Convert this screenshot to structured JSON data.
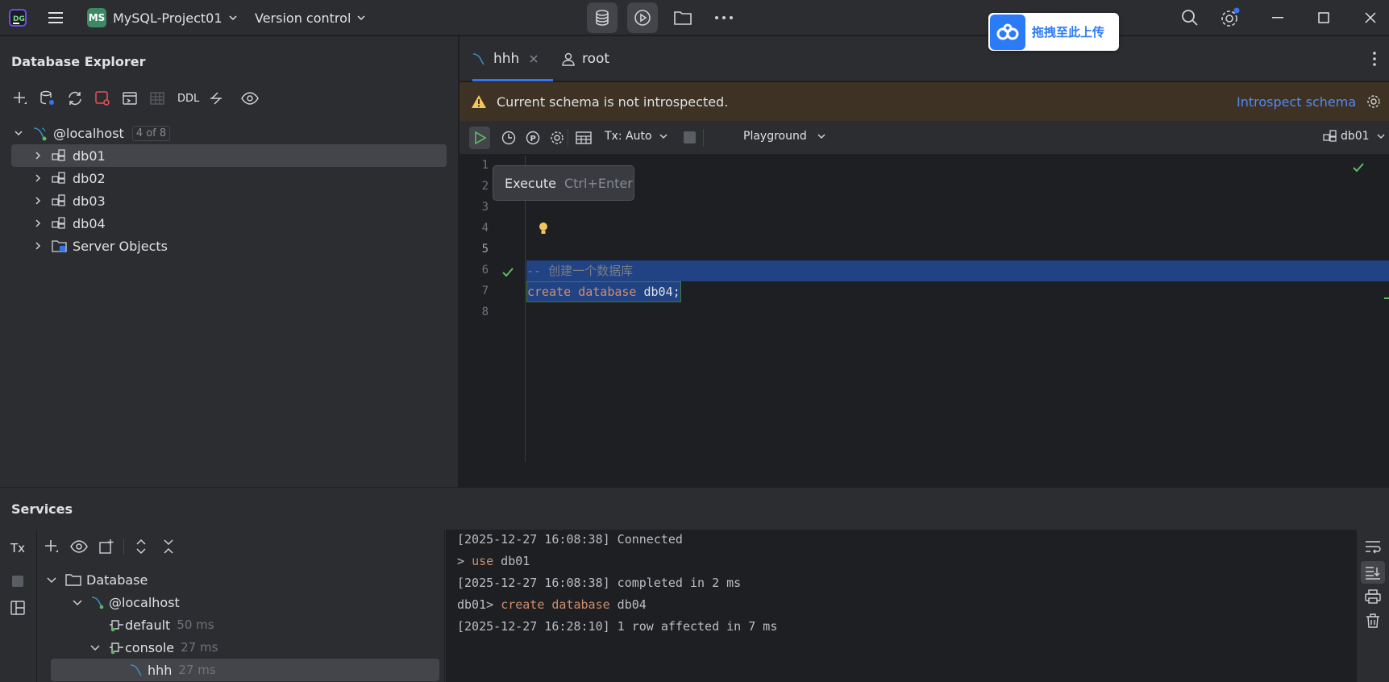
{
  "titlebar": {
    "project_badge": "MS",
    "project_name": "MySQL-Project01",
    "vcs_label": "Version control",
    "icons": [
      "app-logo-icon",
      "hamburger-icon",
      "database-icon",
      "run-services-icon",
      "folder-icon",
      "more-icon",
      "search-icon",
      "settings-icon",
      "minimize-icon",
      "maximize-icon",
      "close-icon"
    ]
  },
  "upload_badge": {
    "label": "拖拽至此上传",
    "icon": "baidu-cloud-icon"
  },
  "explorer": {
    "title": "Database Explorer",
    "ddl_label": "DDL",
    "host": "@localhost",
    "host_count": "4 of 8",
    "items": [
      {
        "label": "db01"
      },
      {
        "label": "db02"
      },
      {
        "label": "db03"
      },
      {
        "label": "db04"
      },
      {
        "label": "Server Objects"
      }
    ]
  },
  "editor": {
    "tabs": [
      {
        "label": "hhh",
        "active": true
      },
      {
        "label": "root",
        "active": false
      }
    ],
    "warning": {
      "text": "Current schema is not introspected.",
      "action": "Introspect schema"
    },
    "toolbar": {
      "tx": "Tx: Auto",
      "playground": "Playground",
      "schema": "db01"
    },
    "tooltip": {
      "label": "Execute",
      "shortcut": "Ctrl+Enter"
    },
    "line_numbers": [
      "1",
      "2",
      "3",
      "4",
      "5",
      "6",
      "7",
      "8"
    ],
    "line5_comment": "-- 创建一个数据库",
    "line6": {
      "kw1": "create",
      "kw2": "database",
      "name": "db04",
      "semi": ";"
    }
  },
  "services": {
    "title": "Services",
    "tx_label": "Tx",
    "tree": {
      "database": "Database",
      "host": "@localhost",
      "default": {
        "label": "default",
        "time": "50 ms"
      },
      "console": {
        "label": "console",
        "time": "27 ms"
      },
      "hhh": {
        "label": "hhh",
        "time": "27 ms"
      }
    },
    "console": {
      "l1": "[2025-12-27 16:08:38] Connected",
      "l2_prompt": "> ",
      "l2_kw": "use",
      "l2_rest": " db01",
      "l3": "[2025-12-27 16:08:38] completed in 2 ms",
      "l4_prompt": "db01> ",
      "l4_kw1": "create",
      "l4_kw2": "database",
      "l4_rest": " db04",
      "l5": "[2025-12-27 16:28:10] 1 row affected in 7 ms"
    }
  },
  "colors": {
    "accent": "#3574f0",
    "keyword": "#cf8e6d",
    "success": "#5fb865",
    "warning_bg": "#3d3223",
    "selection": "#214283"
  }
}
